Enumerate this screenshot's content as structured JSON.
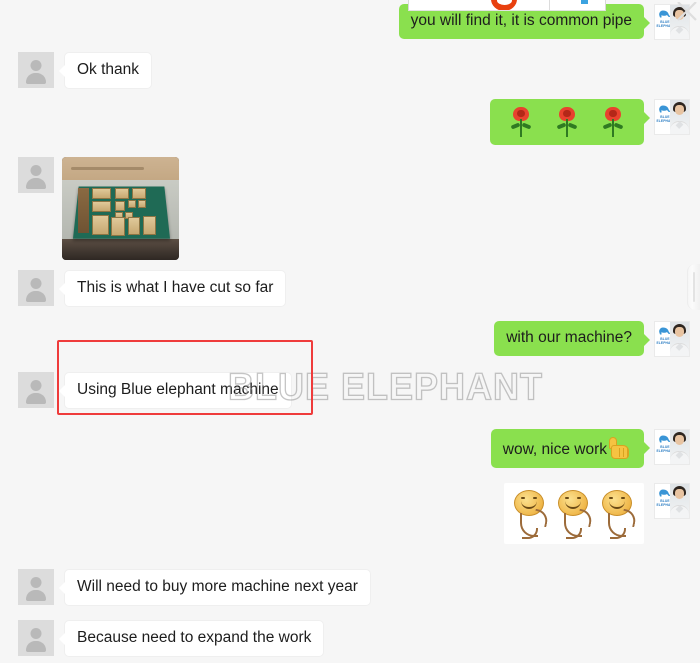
{
  "app": {
    "name": "WeChat Chat Conversation Screenshot",
    "background_color": "#f6f6f6",
    "outgoing_bubble_color": "#8ae04e",
    "incoming_bubble_color": "#ffffff",
    "highlight_color": "#ef3b3b"
  },
  "watermark": {
    "text": "BLUE ELEPHANT"
  },
  "top_strip": {
    "logo_icon": "red-circle-logo",
    "blue_marker_icon": "blue-tick-icon"
  },
  "close_mark": {
    "icon": "close-x-icon"
  },
  "scroll_hint": {
    "icon": "scrollbar-thumb"
  },
  "avatars": {
    "contact_label": "contact-avatar-placeholder",
    "company_label": "company-avatar",
    "company_logo_text": "BLUE ELEPHANT"
  },
  "messages": [
    {
      "id": "msg-1",
      "side": "out",
      "type": "text",
      "text": "you will find it, it is common pipe"
    },
    {
      "id": "msg-2",
      "side": "in",
      "type": "text",
      "text": "Ok thank"
    },
    {
      "id": "msg-3",
      "side": "out",
      "type": "emoji",
      "emoji": "rose",
      "count": 3,
      "text": ""
    },
    {
      "id": "msg-4",
      "side": "in",
      "type": "image",
      "text": "",
      "image_alt": "photo of wood pieces cut on a green CNC router bed"
    },
    {
      "id": "msg-5",
      "side": "in",
      "type": "text",
      "text": "This is what I have cut so far"
    },
    {
      "id": "msg-6",
      "side": "out",
      "type": "text",
      "text": "with our machine?"
    },
    {
      "id": "msg-7",
      "side": "in",
      "type": "text",
      "text": "Using Blue elephant machine",
      "highlighted": true
    },
    {
      "id": "msg-8",
      "side": "out",
      "type": "text_emoji",
      "text": "wow, nice work",
      "emoji": "thumbs-up"
    },
    {
      "id": "msg-9",
      "side": "out",
      "type": "sticker",
      "sticker": "dancing-smiley",
      "count": 3,
      "text": ""
    },
    {
      "id": "msg-10",
      "side": "in",
      "type": "text",
      "text": "Will need to buy more machine next year"
    },
    {
      "id": "msg-11",
      "side": "in",
      "type": "text",
      "text": "Because need to expand the work"
    }
  ]
}
